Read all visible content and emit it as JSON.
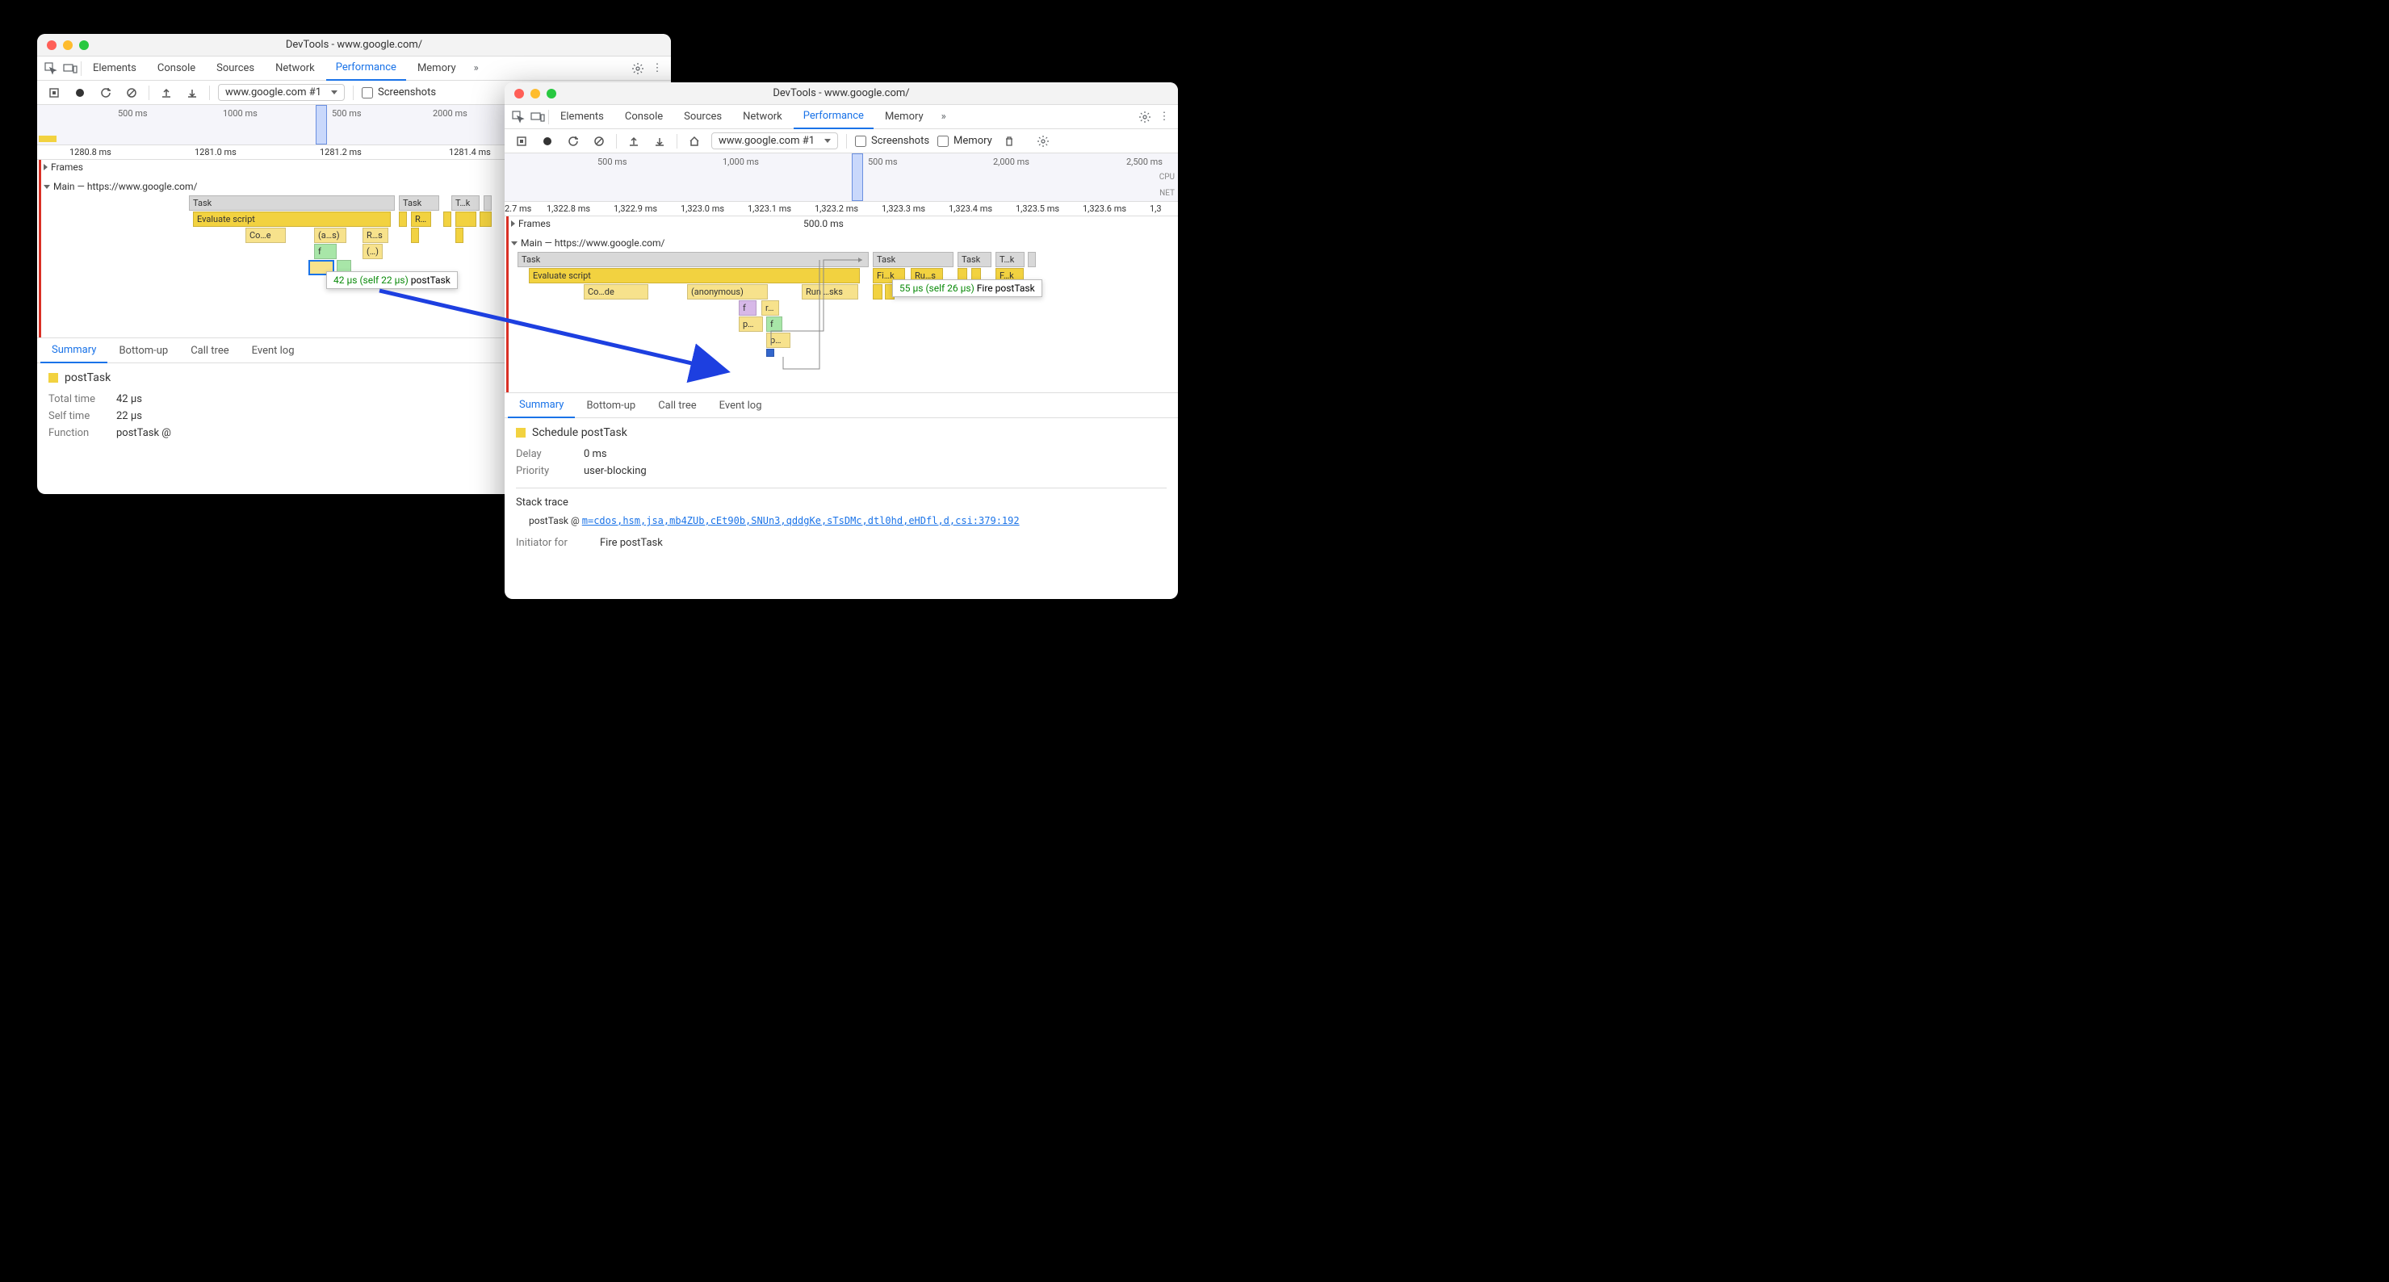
{
  "window1": {
    "title": "DevTools - www.google.com/",
    "tabs": [
      "Elements",
      "Console",
      "Sources",
      "Network",
      "Performance",
      "Memory"
    ],
    "active_tab": "Performance",
    "record_select": "www.google.com #1",
    "screenshots_label": "Screenshots",
    "overview_ticks": [
      "500 ms",
      "1000 ms",
      "500 ms",
      "2000 ms"
    ],
    "ruler_ticks": [
      "1280.8 ms",
      "1281.0 ms",
      "1281.2 ms",
      "1281.4 ms"
    ],
    "frames_label": "Frames",
    "main_label": "Main — https://www.google.com/",
    "bars": {
      "task1": "Task",
      "task2": "Task",
      "task3": "T…k",
      "eval": "Evaluate script",
      "run": "R…",
      "code": "Co…e",
      "anon": "(a…s)",
      "runs": "R…s",
      "f": "f",
      "paren": "(…)"
    },
    "tooltip": {
      "time": "42 µs (self 22 µs)",
      "name": "postTask"
    },
    "subtabs": [
      "Summary",
      "Bottom-up",
      "Call tree",
      "Event log"
    ],
    "summary": {
      "title": "postTask",
      "total_k": "Total time",
      "total_v": "42 µs",
      "self_k": "Self time",
      "self_v": "22 µs",
      "func_k": "Function",
      "func_v": "postTask @"
    }
  },
  "window2": {
    "title": "DevTools - www.google.com/",
    "tabs": [
      "Elements",
      "Console",
      "Sources",
      "Network",
      "Performance",
      "Memory"
    ],
    "active_tab": "Performance",
    "record_select": "www.google.com #1",
    "screenshots_label": "Screenshots",
    "memory_label": "Memory",
    "overview_ticks": [
      "500 ms",
      "1,000 ms",
      "500 ms",
      "2,000 ms",
      "2,500 ms"
    ],
    "cpu_label": "CPU",
    "net_label": "NET",
    "ruler_ticks": [
      "2.7 ms",
      "1,322.8 ms",
      "1,322.9 ms",
      "1,323.0 ms",
      "1,323.1 ms",
      "1,323.2 ms",
      "1,323.3 ms",
      "1,323.4 ms",
      "1,323.5 ms",
      "1,323.6 ms",
      "1,3"
    ],
    "frames_label": "Frames",
    "frames_dur": "500.0 ms",
    "main_label": "Main — https://www.google.com/",
    "bars": {
      "task1": "Task",
      "task2": "Task",
      "task3": "Task",
      "task4": "T…k",
      "eval": "Evaluate script",
      "fik": "Fi…k",
      "rus": "Ru…s",
      "fk": "F…k",
      "code": "Co…de",
      "anon": "(anonymous)",
      "runsks": "Run …sks",
      "f": "f",
      "r": "r…",
      "p1": "p…",
      "f2": "f",
      "p2": "p…"
    },
    "tooltip": {
      "time": "55 µs (self 26 µs)",
      "name": "Fire postTask"
    },
    "subtabs": [
      "Summary",
      "Bottom-up",
      "Call tree",
      "Event log"
    ],
    "summary": {
      "title": "Schedule postTask",
      "delay_k": "Delay",
      "delay_v": "0 ms",
      "prio_k": "Priority",
      "prio_v": "user-blocking",
      "stack_h": "Stack trace",
      "stack_call": "postTask @",
      "stack_link": "m=cdos,hsm,jsa,mb4ZUb,cEt90b,SNUn3,qddgKe,sTsDMc,dtl0hd,eHDfl,d,csi:379:192",
      "init_k": "Initiator for",
      "init_v": "Fire postTask"
    }
  }
}
